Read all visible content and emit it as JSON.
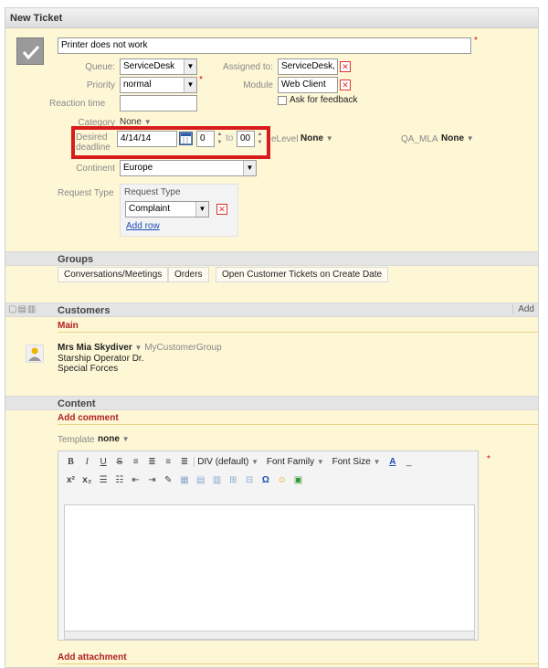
{
  "window": {
    "title": "New Ticket"
  },
  "ticket": {
    "subject": "Printer does not work",
    "queue_label": "Queue:",
    "queue_value": "ServiceDesk",
    "assigned_label": "Assigned to:",
    "assigned_value": "ServiceDesk, Se",
    "priority_label": "Priority",
    "priority_value": "normal",
    "module_label": "Module",
    "module_value": "Web Client",
    "reaction_label": "Reaction time",
    "feedback_label": "Ask for feedback",
    "category_label": "Category",
    "category_value": "None",
    "deadline_label": "Desired deadline",
    "deadline_date": "4/14/14",
    "deadline_hour": "0",
    "deadline_sep": "to",
    "deadline_min": "00",
    "servicelevel_label": "eLevel",
    "servicelevel_value": "None",
    "qamla_label": "QA_MLA",
    "qamla_value": "None",
    "continent_label": "Continent",
    "continent_value": "Europe",
    "request_label": "Request Type",
    "request_header": "Request Type",
    "request_value": "Complaint",
    "add_row": "Add row"
  },
  "groups": {
    "title": "Groups",
    "items": [
      "Conversations/Meetings",
      "Orders",
      "Open Customer Tickets on Create Date"
    ]
  },
  "customers": {
    "title": "Customers",
    "add": "Add",
    "main": "Main",
    "name": "Mrs Mia Skydiver",
    "group": "MyCustomerGroup",
    "line1": "Starship Operator Dr.",
    "line2": "Special Forces"
  },
  "content": {
    "title": "Content",
    "add_comment": "Add comment",
    "template_label": "Template",
    "template_value": "none",
    "format_value": "DIV (default)",
    "font_family": "Font Family",
    "font_size": "Font Size",
    "add_attachment": "Add attachment"
  },
  "colors": {
    "highlight": "#d81b1b",
    "section_bg": "#fdf7d6",
    "link": "#1d4fb7",
    "heading_red": "#b02222"
  }
}
